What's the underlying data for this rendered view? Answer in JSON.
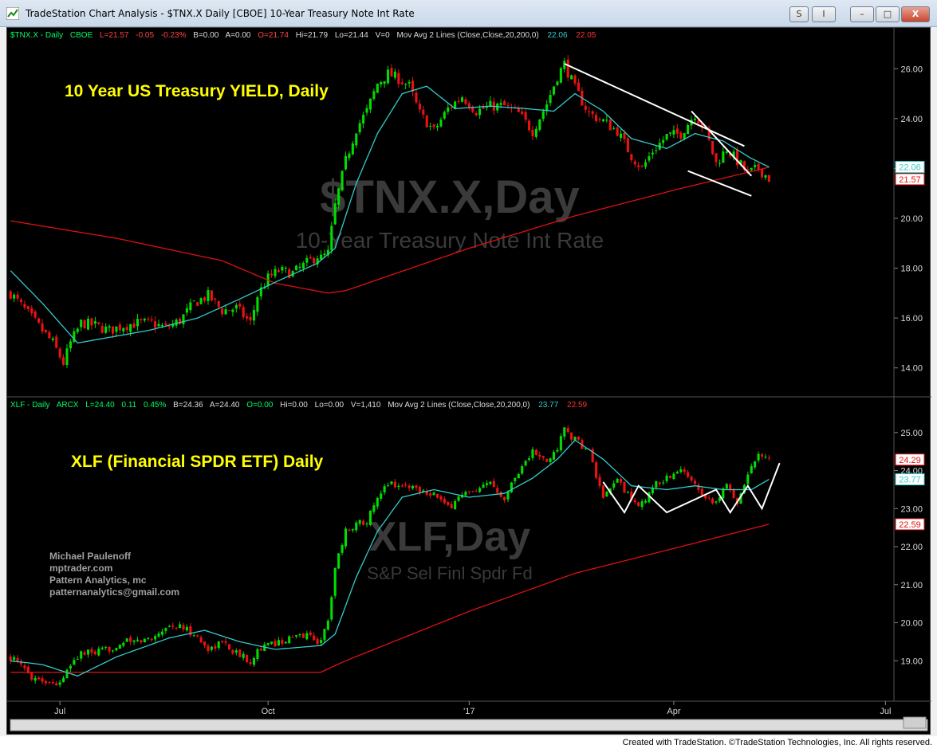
{
  "window": {
    "title": "TradeStation Chart Analysis - $TNX.X Daily [CBOE] 10-Year Treasury Note Int Rate",
    "buttons": {
      "s": "S",
      "i": "I",
      "minimize": "–",
      "maximize": "□",
      "close": "X"
    }
  },
  "credit": "Created with TradeStation. ©TradeStation Technologies, Inc. All rights reserved.",
  "colors": {
    "background": "#000000",
    "up_candle": "#00dd00",
    "down_candle": "#ee1111",
    "ma20": "#33cccc",
    "ma200": "#dd1111",
    "axis_text": "#d8d8d8",
    "title_text": "#ffff00",
    "header_green": "#00ff66",
    "trendline": "#ffffff",
    "watermark": "#3a3a3a"
  },
  "chart_data": [
    {
      "type": "candlestick",
      "symbol": "$TNX.X",
      "annotation": "10 Year US Treasury YIELD, Daily",
      "watermark": "$TNX.X,Day",
      "watermark_sub": "10-Year Treasury Note Int Rate",
      "header": {
        "symbol": "$TNX.X - Daily",
        "exchange": "CBOE",
        "last": "L=21.57",
        "change": "-0.05",
        "pct": "-0.23%",
        "bid": "B=0.00",
        "ask": "A=0.00",
        "open": "O=21.74",
        "high": "Hi=21.79",
        "low": "Lo=21.44",
        "volume": "V=0",
        "study": "Mov Avg 2 Lines (Close,Close,20,200,0)",
        "ma20_value": "22.06",
        "ma200_value": "22.05"
      },
      "yticks": [
        "14.00",
        "16.00",
        "18.00",
        "20.00",
        "22.00",
        "24.00",
        "26.00"
      ],
      "ylim": [
        13.0,
        27.0
      ],
      "price_labels": {
        "ma20": "22.06",
        "last": "21.57"
      },
      "path_points": [
        [
          0,
          17.0
        ],
        [
          6,
          16.0
        ],
        [
          12,
          15.0
        ],
        [
          15,
          14.2
        ],
        [
          17,
          15.0
        ],
        [
          20,
          15.8
        ],
        [
          24,
          15.7
        ],
        [
          28,
          15.5
        ],
        [
          32,
          15.7
        ],
        [
          36,
          15.8
        ],
        [
          40,
          15.8
        ],
        [
          44,
          15.6
        ],
        [
          48,
          15.9
        ],
        [
          52,
          16.6
        ],
        [
          56,
          16.9
        ],
        [
          60,
          16.3
        ],
        [
          64,
          16.4
        ],
        [
          68,
          15.8
        ],
        [
          70,
          16.9
        ],
        [
          73,
          17.6
        ],
        [
          76,
          17.9
        ],
        [
          80,
          17.8
        ],
        [
          84,
          18.2
        ],
        [
          87,
          18.5
        ],
        [
          88,
          18.4
        ],
        [
          90,
          18.6
        ],
        [
          92,
          20.5
        ],
        [
          95,
          22.3
        ],
        [
          98,
          23.6
        ],
        [
          101,
          24.3
        ],
        [
          104,
          25.4
        ],
        [
          107,
          25.8
        ],
        [
          110,
          25.6
        ],
        [
          113,
          25.3
        ],
        [
          116,
          24.2
        ],
        [
          120,
          23.5
        ],
        [
          124,
          24.4
        ],
        [
          128,
          24.9
        ],
        [
          132,
          24.3
        ],
        [
          136,
          24.5
        ],
        [
          140,
          24.5
        ],
        [
          144,
          24.2
        ],
        [
          148,
          23.5
        ],
        [
          152,
          24.6
        ],
        [
          155,
          25.7
        ],
        [
          157,
          26.2
        ],
        [
          160,
          25.2
        ],
        [
          164,
          24.2
        ],
        [
          168,
          23.9
        ],
        [
          172,
          23.5
        ],
        [
          176,
          22.5
        ],
        [
          179,
          22.0
        ],
        [
          182,
          22.7
        ],
        [
          186,
          23.3
        ],
        [
          190,
          23.4
        ],
        [
          194,
          24.2
        ],
        [
          197,
          23.5
        ],
        [
          200,
          22.2
        ],
        [
          203,
          22.8
        ],
        [
          206,
          22.3
        ],
        [
          209,
          21.8
        ],
        [
          212,
          22.0
        ],
        [
          215,
          21.6
        ]
      ],
      "ma20_anchor": [
        [
          0,
          17.9
        ],
        [
          9,
          16.6
        ],
        [
          19,
          15.0
        ],
        [
          39,
          15.5
        ],
        [
          53,
          16.0
        ],
        [
          64,
          16.7
        ],
        [
          76,
          17.5
        ],
        [
          87,
          18.2
        ],
        [
          92,
          18.8
        ],
        [
          98,
          21.4
        ],
        [
          104,
          23.4
        ],
        [
          111,
          25.0
        ],
        [
          118,
          25.3
        ],
        [
          126,
          24.4
        ],
        [
          136,
          24.5
        ],
        [
          146,
          24.4
        ],
        [
          154,
          24.3
        ],
        [
          160,
          25.0
        ],
        [
          168,
          24.3
        ],
        [
          176,
          23.2
        ],
        [
          186,
          22.8
        ],
        [
          194,
          23.4
        ],
        [
          202,
          23.1
        ],
        [
          210,
          22.4
        ],
        [
          215,
          22.06
        ]
      ],
      "ma200_anchor": [
        [
          0,
          19.9
        ],
        [
          30,
          19.2
        ],
        [
          60,
          18.3
        ],
        [
          75,
          17.4
        ],
        [
          90,
          17.0
        ],
        [
          95,
          17.1
        ],
        [
          130,
          18.8
        ],
        [
          160,
          20.1
        ],
        [
          190,
          21.2
        ],
        [
          215,
          22.05
        ]
      ],
      "trendlines": [
        [
          [
            157,
            26.2
          ],
          [
            208,
            22.9
          ]
        ],
        [
          [
            193,
            24.3
          ],
          [
            210,
            21.7
          ]
        ],
        [
          [
            192,
            21.9
          ],
          [
            210,
            20.9
          ]
        ]
      ]
    },
    {
      "type": "candlestick",
      "symbol": "XLF",
      "annotation": "XLF (Financial SPDR ETF) Daily",
      "watermark": "XLF,Day",
      "watermark_sub": "S&P Sel Finl Spdr Fd",
      "header": {
        "symbol": "XLF - Daily",
        "exchange": "ARCX",
        "last": "L=24.40",
        "change": "0.11",
        "pct": "0.45%",
        "bid": "B=24.36",
        "ask": "A=24.40",
        "open": "O=0.00",
        "high": "Hi=0.00",
        "low": "Lo=0.00",
        "volume": "V=1,410",
        "study": "Mov Avg 2 Lines (Close,Close,20,200,0)",
        "ma20_value": "23.77",
        "ma200_value": "22.59"
      },
      "yticks": [
        "19.00",
        "20.00",
        "21.00",
        "22.00",
        "23.00",
        "24.00",
        "25.00"
      ],
      "ylim": [
        18.0,
        25.5
      ],
      "price_labels": {
        "last": "24.29",
        "ma20": "23.77",
        "ma200": "22.59"
      },
      "path_points": [
        [
          0,
          19.1
        ],
        [
          6,
          18.6
        ],
        [
          12,
          18.4
        ],
        [
          15,
          18.5
        ],
        [
          17,
          18.9
        ],
        [
          20,
          19.2
        ],
        [
          24,
          19.2
        ],
        [
          28,
          19.3
        ],
        [
          32,
          19.5
        ],
        [
          36,
          19.5
        ],
        [
          40,
          19.6
        ],
        [
          44,
          19.9
        ],
        [
          48,
          19.9
        ],
        [
          52,
          19.7
        ],
        [
          56,
          19.3
        ],
        [
          60,
          19.5
        ],
        [
          64,
          19.2
        ],
        [
          68,
          19.0
        ],
        [
          70,
          19.3
        ],
        [
          73,
          19.4
        ],
        [
          76,
          19.5
        ],
        [
          80,
          19.6
        ],
        [
          84,
          19.7
        ],
        [
          87,
          19.5
        ],
        [
          88,
          19.6
        ],
        [
          90,
          20.0
        ],
        [
          92,
          21.5
        ],
        [
          95,
          22.4
        ],
        [
          98,
          22.6
        ],
        [
          101,
          22.7
        ],
        [
          104,
          23.2
        ],
        [
          107,
          23.7
        ],
        [
          110,
          23.6
        ],
        [
          113,
          23.6
        ],
        [
          116,
          23.5
        ],
        [
          120,
          23.4
        ],
        [
          124,
          23.0
        ],
        [
          128,
          23.4
        ],
        [
          132,
          23.4
        ],
        [
          136,
          23.7
        ],
        [
          140,
          23.3
        ],
        [
          144,
          24.0
        ],
        [
          148,
          24.5
        ],
        [
          152,
          24.2
        ],
        [
          155,
          24.6
        ],
        [
          157,
          25.1
        ],
        [
          160,
          24.8
        ],
        [
          164,
          24.5
        ],
        [
          168,
          23.2
        ],
        [
          172,
          23.8
        ],
        [
          176,
          23.2
        ],
        [
          179,
          23.1
        ],
        [
          182,
          23.6
        ],
        [
          186,
          23.8
        ],
        [
          190,
          24.0
        ],
        [
          194,
          23.7
        ],
        [
          197,
          23.3
        ],
        [
          200,
          23.2
        ],
        [
          203,
          23.6
        ],
        [
          206,
          23.2
        ],
        [
          209,
          23.9
        ],
        [
          212,
          24.5
        ],
        [
          215,
          24.3
        ]
      ],
      "ma20_anchor": [
        [
          0,
          19.0
        ],
        [
          9,
          18.9
        ],
        [
          19,
          18.6
        ],
        [
          30,
          19.1
        ],
        [
          45,
          19.6
        ],
        [
          55,
          19.8
        ],
        [
          65,
          19.5
        ],
        [
          75,
          19.3
        ],
        [
          88,
          19.4
        ],
        [
          92,
          19.7
        ],
        [
          98,
          21.2
        ],
        [
          104,
          22.4
        ],
        [
          111,
          23.3
        ],
        [
          120,
          23.5
        ],
        [
          130,
          23.3
        ],
        [
          140,
          23.4
        ],
        [
          148,
          23.8
        ],
        [
          155,
          24.3
        ],
        [
          160,
          24.8
        ],
        [
          168,
          24.3
        ],
        [
          176,
          23.6
        ],
        [
          186,
          23.5
        ],
        [
          194,
          23.6
        ],
        [
          202,
          23.5
        ],
        [
          210,
          23.5
        ],
        [
          215,
          23.77
        ]
      ],
      "ma200_anchor": [
        [
          0,
          18.7
        ],
        [
          40,
          18.7
        ],
        [
          88,
          18.7
        ],
        [
          95,
          19.0
        ],
        [
          130,
          20.3
        ],
        [
          160,
          21.3
        ],
        [
          190,
          22.0
        ],
        [
          215,
          22.59
        ]
      ],
      "trendlines": [
        [
          [
            168,
            23.7
          ],
          [
            174,
            22.9
          ],
          [
            178,
            23.6
          ],
          [
            186,
            22.9
          ],
          [
            200,
            23.5
          ],
          [
            204,
            22.9
          ],
          [
            209,
            23.6
          ],
          [
            213,
            23.0
          ],
          [
            218,
            24.2
          ]
        ]
      ]
    }
  ],
  "x_axis": {
    "labels": [
      "Jul",
      "Oct",
      "'17",
      "Apr",
      "Jul"
    ],
    "positions": [
      14,
      73,
      130,
      188,
      248
    ],
    "total_bars": 250
  },
  "signature": [
    "Michael Paulenoff",
    "mptrader.com",
    "Pattern Analytics, mc",
    "patternanalytics@gmail.com"
  ]
}
